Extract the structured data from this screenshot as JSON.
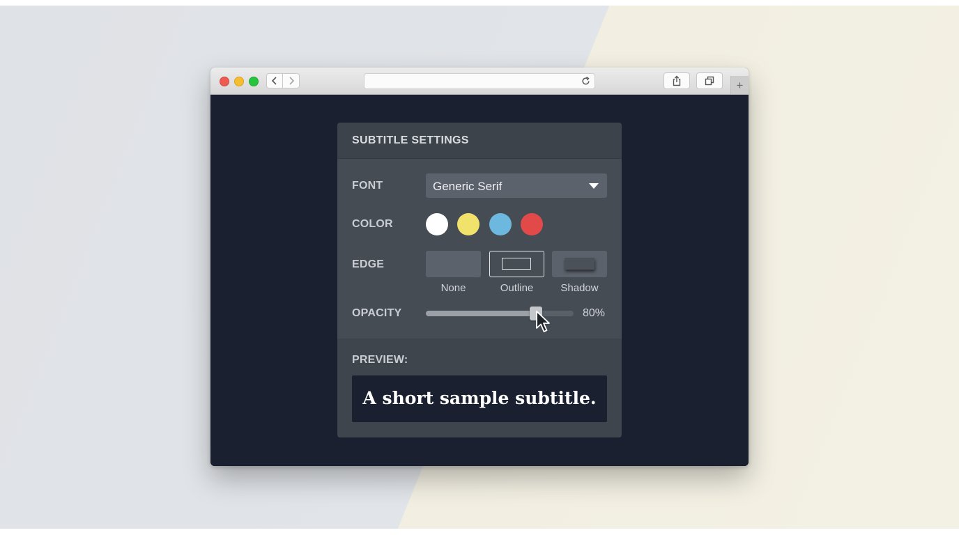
{
  "panel": {
    "title": "SUBTITLE SETTINGS",
    "font": {
      "label": "FONT",
      "value": "Generic Serif"
    },
    "color": {
      "label": "COLOR",
      "swatches": [
        "#ffffff",
        "#f0e26a",
        "#6cb8de",
        "#e24a4a"
      ]
    },
    "edge": {
      "label": "EDGE",
      "options": [
        "None",
        "Outline",
        "Shadow"
      ],
      "selected": "Outline"
    },
    "opacity": {
      "label": "OPACITY",
      "value_text": "80%",
      "value": 0.8
    },
    "preview": {
      "label": "PREVIEW:",
      "text": "A short sample subtitle."
    }
  },
  "colors": {
    "page_bg": "#1b2030",
    "panel_bg": "#464c54",
    "control_bg": "#5c626b"
  },
  "icons": {
    "back": "chevron-left-icon",
    "forward": "chevron-right-icon",
    "reload": "reload-icon",
    "share": "share-icon",
    "tabs": "tabs-icon",
    "new_tab": "plus-icon",
    "cursor": "mouse-cursor-icon",
    "dropdown": "caret-down-icon"
  }
}
